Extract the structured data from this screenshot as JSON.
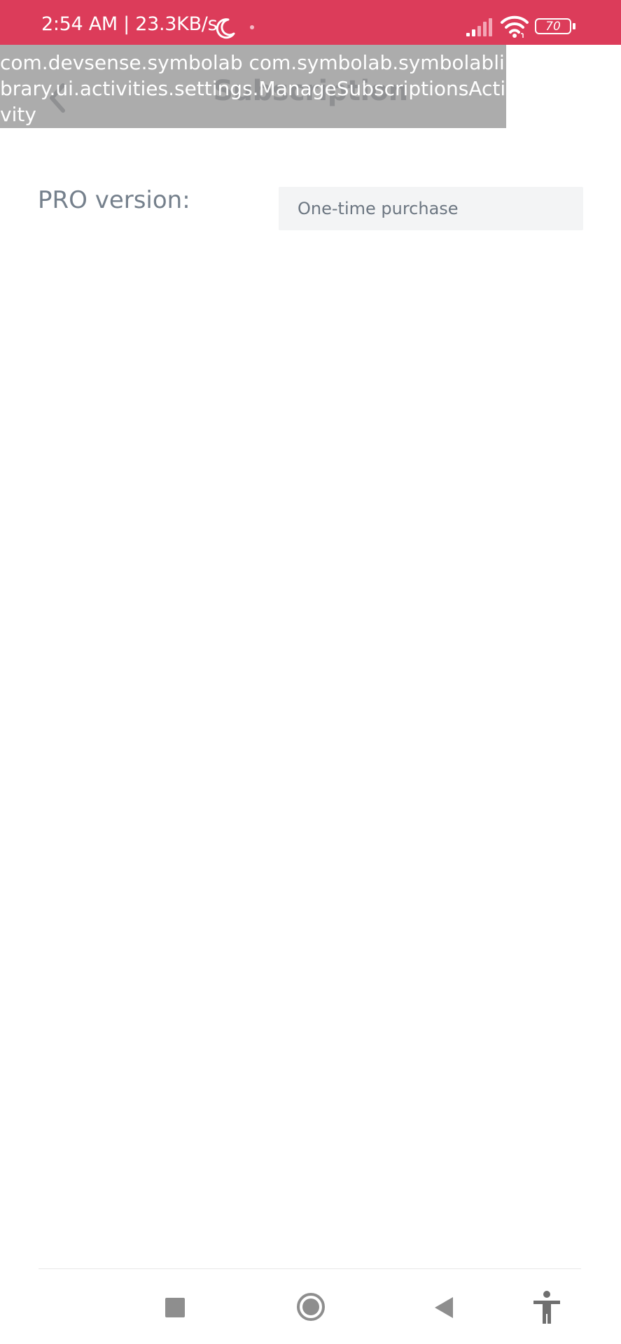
{
  "status_bar": {
    "time_text": "2:54 AM | 23.3KB/s",
    "battery_level": "70",
    "icons": [
      "moon-icon",
      "dot-icon",
      "signal-icon",
      "wifi-icon",
      "battery-icon"
    ],
    "background_color": "#dc3c5a"
  },
  "app_bar": {
    "title": "Subscription",
    "back_icon": "chevron-left-icon"
  },
  "activity_overlay": {
    "text": "com.devsense.symbolab com.symbolab.symbolablibrary.ui.activities.settings.ManageSubscriptionsActivity"
  },
  "content": {
    "pro_label": "PRO version:",
    "purchase_value": "One-time purchase"
  },
  "nav_bar": {
    "icons": [
      "recent-apps-icon",
      "home-icon",
      "back-triangle-icon",
      "accessibility-icon"
    ]
  }
}
